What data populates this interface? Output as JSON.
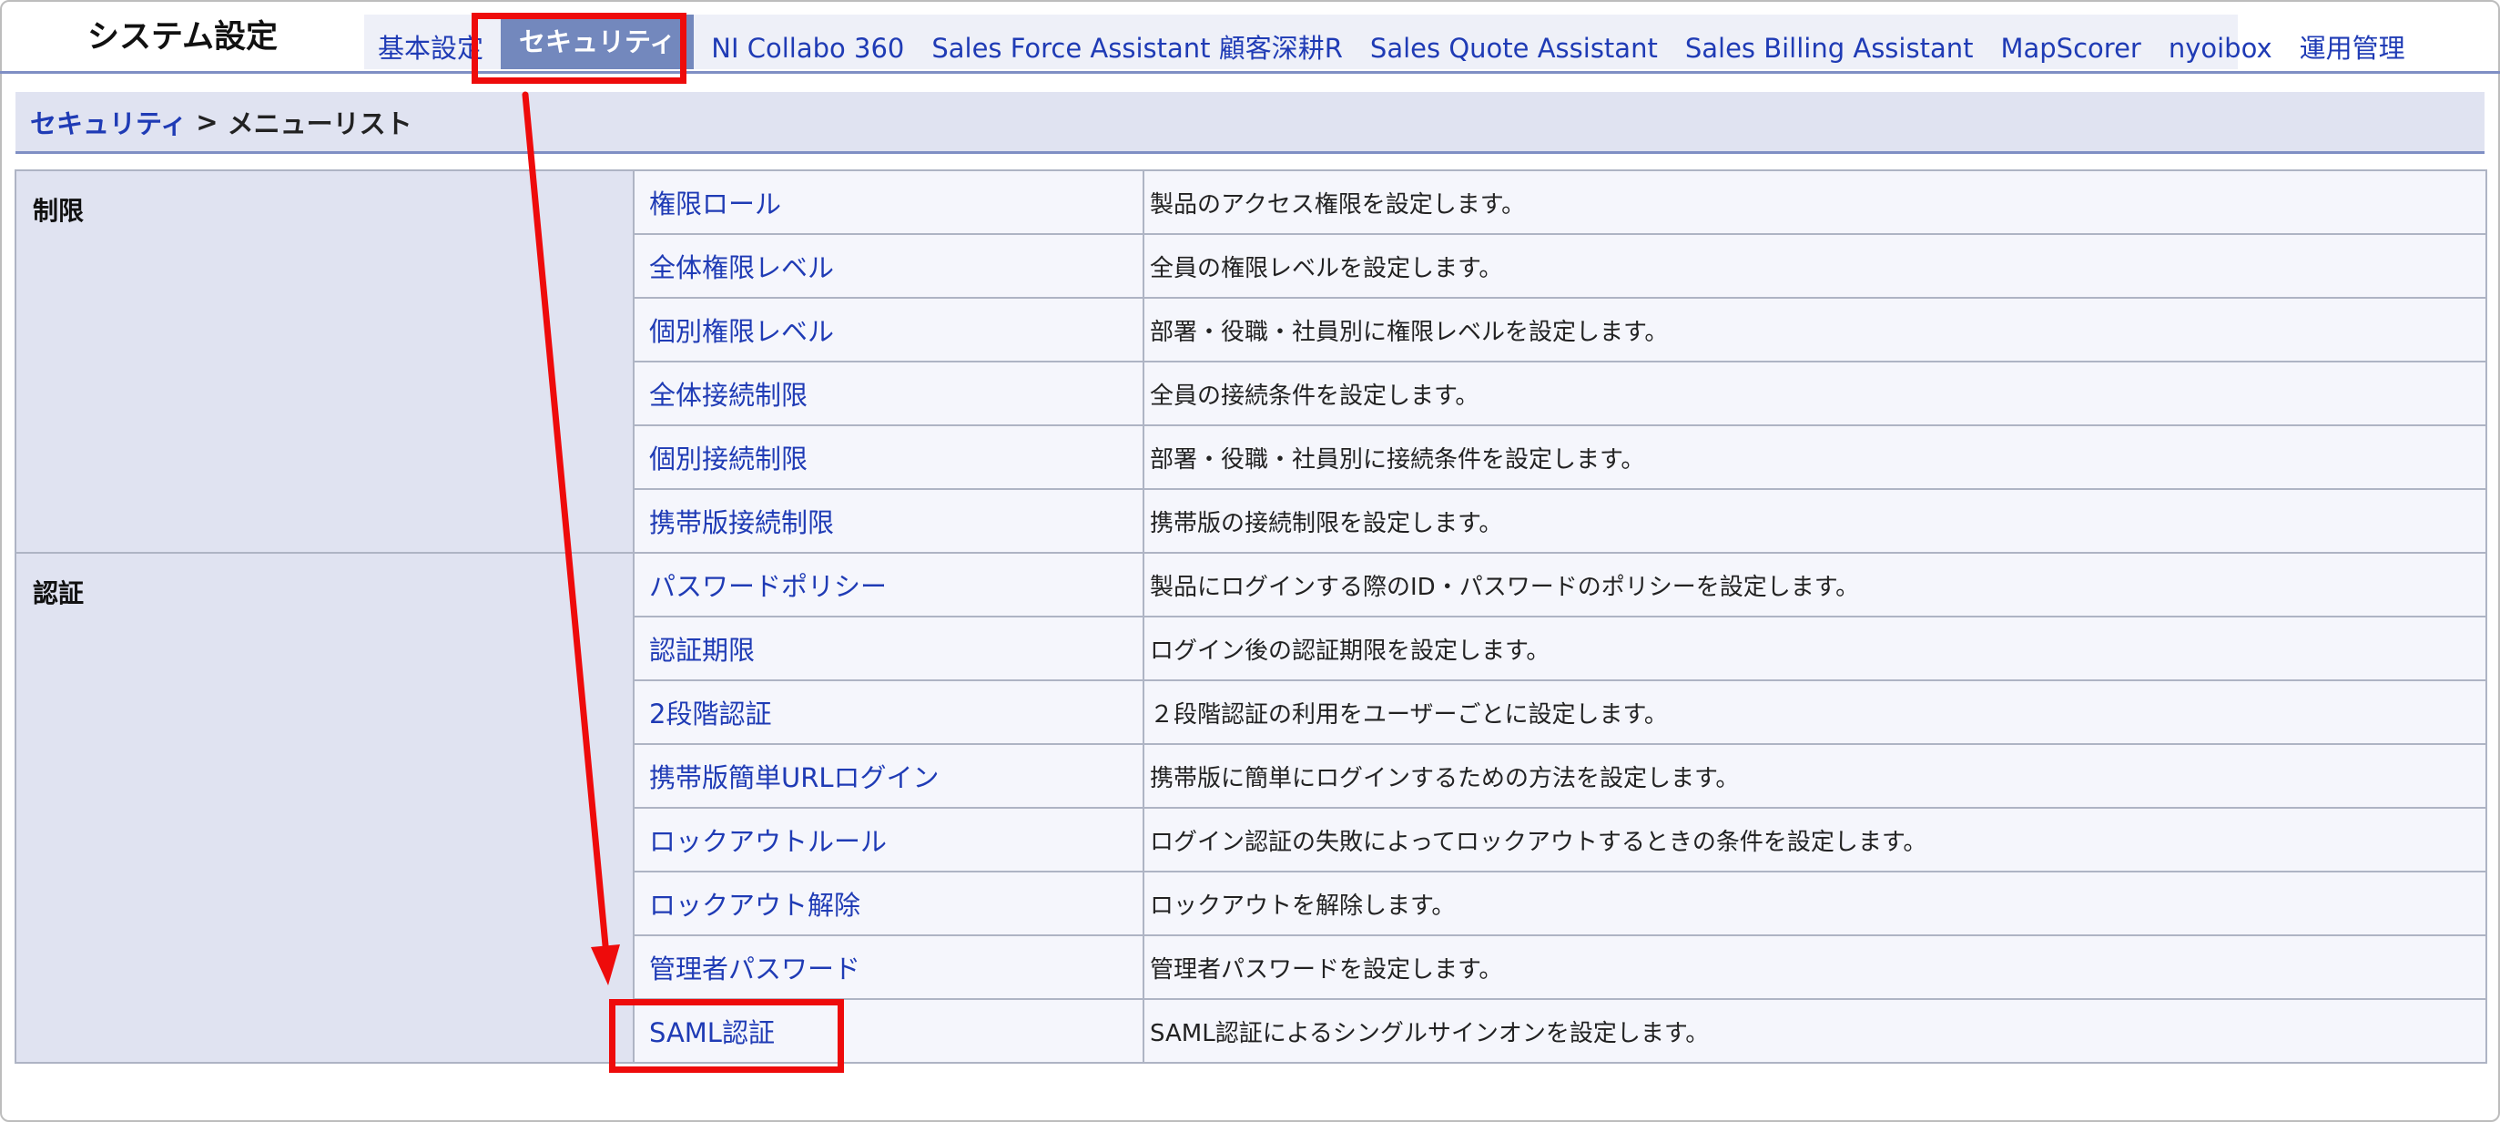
{
  "app_title": "システム設定",
  "tabs": [
    {
      "label": "基本設定",
      "active": false
    },
    {
      "label": "セキュリティ",
      "active": true
    },
    {
      "label": "NI Collabo 360",
      "active": false
    },
    {
      "label": "Sales Force Assistant 顧客深耕R",
      "active": false
    },
    {
      "label": "Sales Quote Assistant",
      "active": false
    },
    {
      "label": "Sales Billing Assistant",
      "active": false
    },
    {
      "label": "MapScorer",
      "active": false
    },
    {
      "label": "nyoibox",
      "active": false
    },
    {
      "label": "運用管理",
      "active": false
    }
  ],
  "breadcrumb": {
    "link": "セキュリティ",
    "separator": ">",
    "current": "メニューリスト"
  },
  "sections": [
    {
      "name": "制限",
      "items": [
        {
          "label": "権限ロール",
          "description": "製品のアクセス権限を設定します。"
        },
        {
          "label": "全体権限レベル",
          "description": "全員の権限レベルを設定します。"
        },
        {
          "label": "個別権限レベル",
          "description": "部署・役職・社員別に権限レベルを設定します。"
        },
        {
          "label": "全体接続制限",
          "description": "全員の接続条件を設定します。"
        },
        {
          "label": "個別接続制限",
          "description": "部署・役職・社員別に接続条件を設定します。"
        },
        {
          "label": "携帯版接続制限",
          "description": "携帯版の接続制限を設定します。"
        }
      ]
    },
    {
      "name": "認証",
      "items": [
        {
          "label": "パスワードポリシー",
          "description": "製品にログインする際のID・パスワードのポリシーを設定します。"
        },
        {
          "label": "認証期限",
          "description": "ログイン後の認証期限を設定します。"
        },
        {
          "label": "2段階認証",
          "description": "２段階認証の利用をユーザーごとに設定します。"
        },
        {
          "label": "携帯版簡単URLログイン",
          "description": "携帯版に簡単にログインするための方法を設定します。"
        },
        {
          "label": "ロックアウトルール",
          "description": "ログイン認証の失敗によってロックアウトするときの条件を設定します。"
        },
        {
          "label": "ロックアウト解除",
          "description": "ロックアウトを解除します。"
        },
        {
          "label": "管理者パスワード",
          "description": "管理者パスワードを設定します。"
        },
        {
          "label": "SAML認証",
          "description": "SAML認証によるシングルサインオンを設定します。"
        }
      ]
    }
  ],
  "colors": {
    "link": "#1f3bb5",
    "active_tab_bg": "#7388bd",
    "section_bg": "#e0e3f1",
    "row_bg": "#f5f6fc",
    "annotation": "#ee0b0b"
  }
}
